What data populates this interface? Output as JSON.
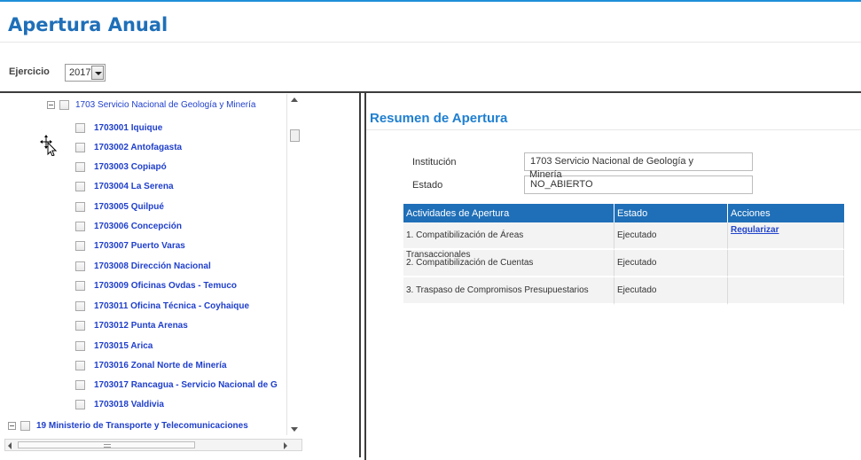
{
  "page": {
    "title": "Apertura Anual",
    "year_label": "Ejercicio",
    "year_value": "2017"
  },
  "tree": {
    "parent": "1703 Servicio Nacional de Geología y Minería",
    "children": [
      "1703001 Iquique",
      "1703002 Antofagasta",
      "1703003 Copiapó",
      "1703004 La Serena",
      "1703005 Quilpué",
      "1703006 Concepción",
      "1703007 Puerto Varas",
      "1703008 Dirección Nacional",
      "1703009 Oficinas Ovdas - Temuco",
      "1703011 Oficina Técnica - Coyhaique",
      "1703012 Punta Arenas",
      "1703015 Arica",
      "1703016 Zonal Norte de Minería",
      "1703017 Rancagua - Servicio Nacional de G",
      "1703018 Valdivia"
    ],
    "next_parent": "19 Ministerio de Transporte y Telecomunicaciones",
    "hscroll_glyph": "III"
  },
  "resumen": {
    "title": "Resumen de Apertura",
    "institucion_label": "Institución",
    "institucion_value": "1703 Servicio Nacional de Geología y",
    "institucion_overflow": "Minería",
    "estado_label": "Estado",
    "estado_value": "NO_ABIERTO"
  },
  "table": {
    "headers": [
      "Actividades de Apertura",
      "Estado",
      "Acciones"
    ],
    "rows": [
      {
        "actividad": "1. Compatibilización de Áreas",
        "estado": "Ejecutado",
        "accion": "Regularizar"
      },
      {
        "actividad": "2. Compatibilización de Cuentas",
        "estado": "Ejecutado",
        "accion": ""
      },
      {
        "actividad": "3. Traspaso de Compromisos Presupuestarios",
        "estado": "Ejecutado",
        "accion": ""
      }
    ],
    "row1_overflow": "Transaccionales"
  },
  "colors": {
    "accent": "#1f6fb8",
    "link": "#1f3fcc",
    "title": "#1f6fb8"
  }
}
